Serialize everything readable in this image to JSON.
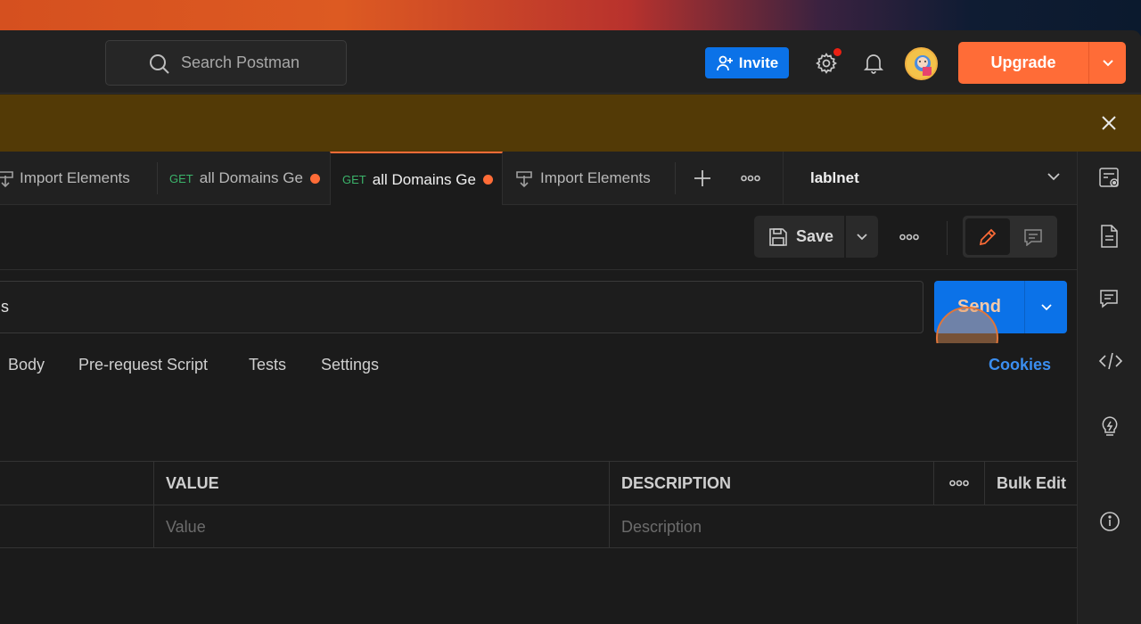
{
  "header": {
    "search_placeholder": "Search Postman",
    "invite_label": "Invite",
    "upgrade_label": "Upgrade"
  },
  "tabs": [
    {
      "method": "",
      "label": "Import Elements",
      "unsaved": false
    },
    {
      "method": "GET",
      "label": "all Domains Ge",
      "unsaved": true
    },
    {
      "method": "GET",
      "label": "all Domains Ge",
      "unsaved": true,
      "active": true
    },
    {
      "method": "",
      "label": "Import Elements",
      "unsaved": false
    }
  ],
  "environment": {
    "name": "lablnet"
  },
  "request": {
    "save_label": "Save",
    "url_visible": "ns",
    "send_label": "Send"
  },
  "sub_tabs": [
    "Body",
    "Pre-request Script",
    "Tests",
    "Settings"
  ],
  "cookies_label": "Cookies",
  "table": {
    "headers": {
      "value": "VALUE",
      "description": "DESCRIPTION",
      "bulk_edit": "Bulk Edit"
    },
    "placeholder_row": {
      "value": "Value",
      "description": "Description"
    }
  },
  "colors": {
    "brand_orange": "#ff6c37",
    "invite_blue": "#0b72e8",
    "banner": "#533a06"
  }
}
